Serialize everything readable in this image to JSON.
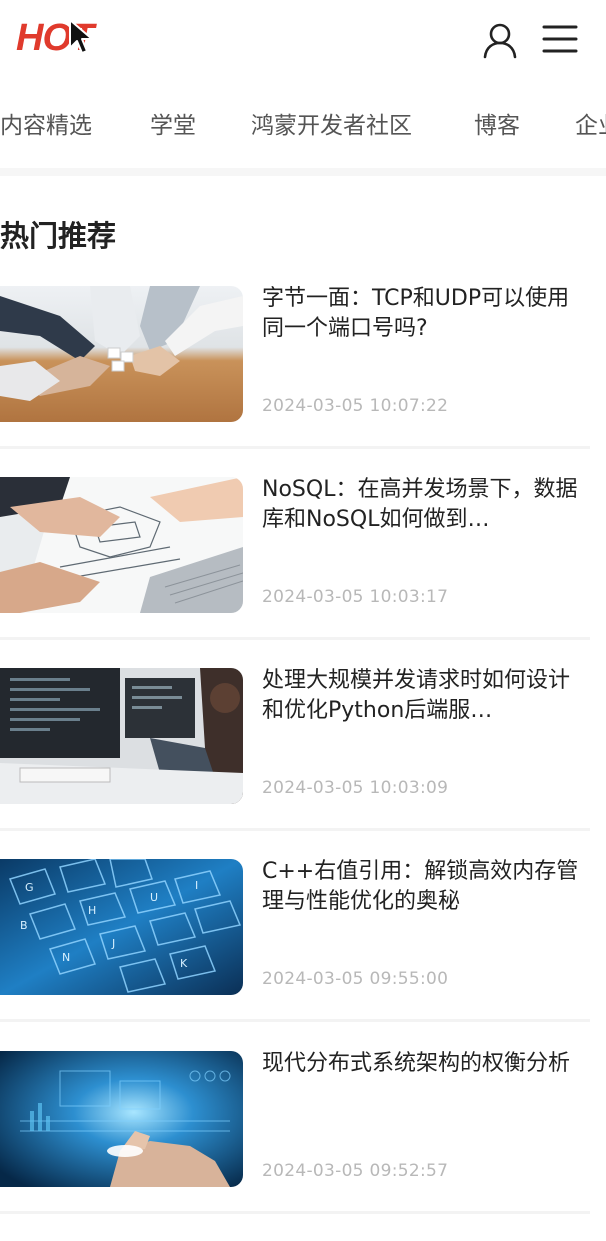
{
  "header": {
    "logo_text": "HOT",
    "user_icon": "user-icon",
    "menu_icon": "menu-icon",
    "logo_color": "#e03a2c"
  },
  "tabs": [
    {
      "label": "内容精选"
    },
    {
      "label": "学堂"
    },
    {
      "label": "鸿蒙开发者社区"
    },
    {
      "label": "博客"
    },
    {
      "label": "企业"
    }
  ],
  "section": {
    "title": "热门推荐"
  },
  "articles": [
    {
      "title": "字节一面：TCP和UDP可以使用同一个端口号吗?",
      "date": "2024-03-05 10:07:22",
      "thumb": "teamwork-puzzle-image"
    },
    {
      "title": "NoSQL：在高并发场景下，数据库和NoSQL如何做到…",
      "date": "2024-03-05 10:03:17",
      "thumb": "blueprint-laptop-image"
    },
    {
      "title": "处理大规模并发请求时如何设计和优化Python后端服…",
      "date": "2024-03-05 10:03:09",
      "thumb": "developers-monitor-image"
    },
    {
      "title": "C++右值引用：解锁高效内存管理与性能优化的奥秘",
      "date": "2024-03-05 09:55:00",
      "thumb": "blue-keyboard-image"
    },
    {
      "title": "现代分布式系统架构的权衡分析",
      "date": "2024-03-05 09:52:57",
      "thumb": "digital-hand-image"
    }
  ]
}
